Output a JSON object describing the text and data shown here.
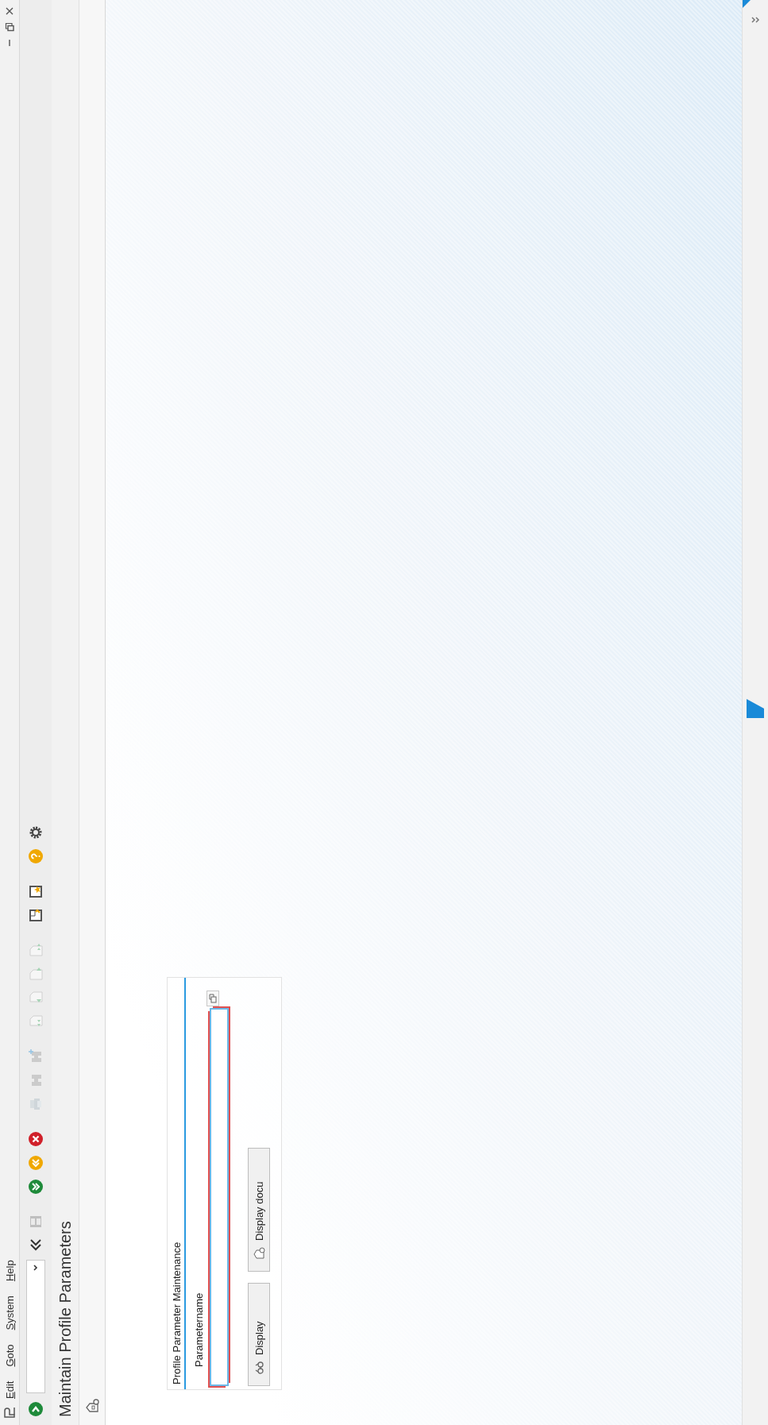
{
  "menu_bar": {
    "items": [
      {
        "label": "Edit"
      },
      {
        "label": "Goto"
      },
      {
        "label": "System"
      },
      {
        "label": "Help"
      }
    ]
  },
  "toolbar": {
    "buttons": [
      {
        "kind": "enter",
        "disabled": false
      },
      {
        "kind": "save",
        "disabled": true
      },
      {
        "kind": "back",
        "disabled": false
      },
      {
        "kind": "exit",
        "disabled": false
      },
      {
        "kind": "cancel",
        "disabled": false
      },
      {
        "kind": "print",
        "disabled": true
      },
      {
        "kind": "find",
        "disabled": true
      },
      {
        "kind": "find-next",
        "disabled": true
      },
      {
        "kind": "first-page",
        "disabled": true
      },
      {
        "kind": "previous-page",
        "disabled": true
      },
      {
        "kind": "next-page",
        "disabled": true
      },
      {
        "kind": "last-page",
        "disabled": true
      },
      {
        "kind": "new-session",
        "disabled": false
      },
      {
        "kind": "shortcut",
        "disabled": false
      },
      {
        "kind": "help",
        "disabled": false
      },
      {
        "kind": "settings",
        "disabled": false
      }
    ]
  },
  "title": "Maintain Profile Parameters",
  "group_box": {
    "title": "Profile Parameter Maintenance",
    "field": {
      "label": "Parametername",
      "required": true
    },
    "buttons": [
      {
        "label": "Display",
        "kind": "display"
      },
      {
        "label": "Display docu",
        "kind": "docu"
      }
    ]
  }
}
